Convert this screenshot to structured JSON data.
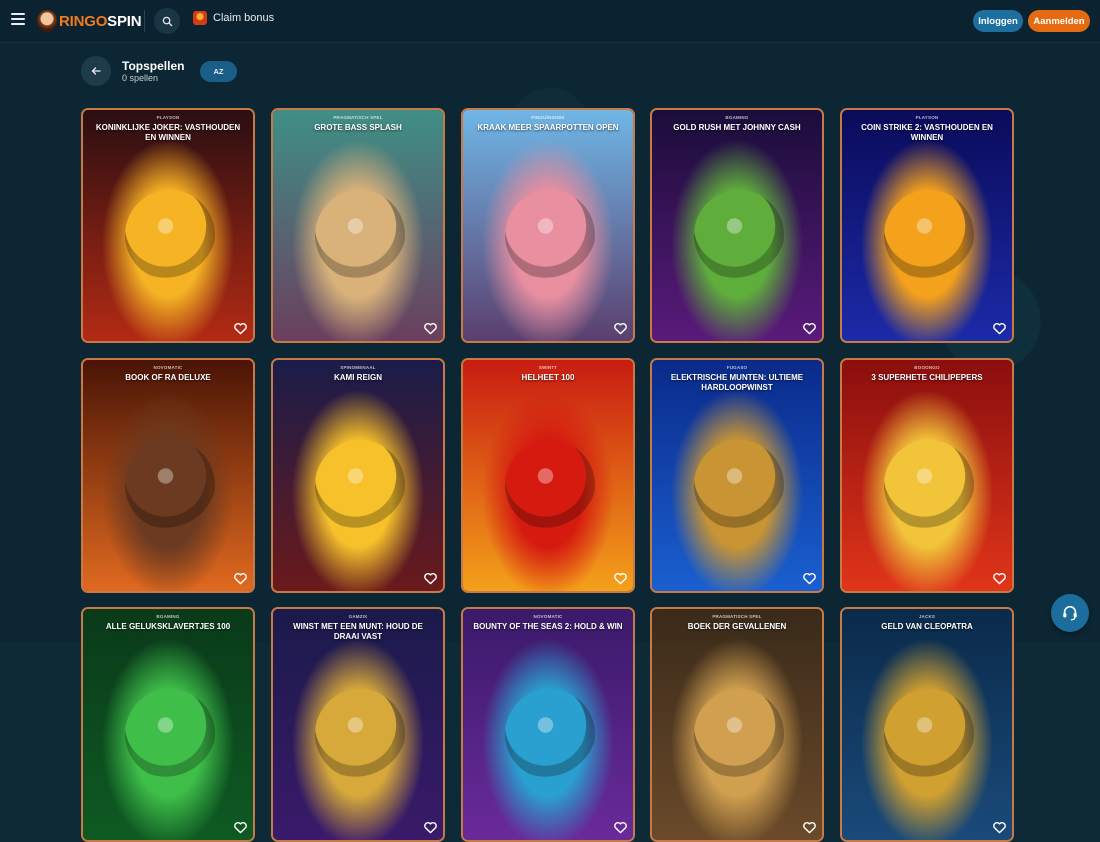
{
  "header": {
    "logo_part1": "RINGO",
    "logo_part2": "SPIN",
    "claim_bonus": "Claim bonus",
    "login_label": "Inloggen",
    "signup_label": "Aanmelden",
    "icons": {
      "menu": "hamburger-menu-icon",
      "search": "search-icon",
      "gift": "gift-icon"
    }
  },
  "page": {
    "title": "Topspellen",
    "count": "0 spellen",
    "sort_label": "AZ"
  },
  "games": [
    {
      "provider": "PLAYSON",
      "name": "KONINKLIJKE JOKER: VASTHOUDEN EN WINNEN",
      "color_top": "#2a0e12",
      "color_bottom": "#b32a14",
      "glow": "#f6b324"
    },
    {
      "provider": "PRAGMATISCH SPEL",
      "name": "GROTE BASS SPLASH",
      "color_top": "#3f8f86",
      "color_bottom": "#6b3f5e",
      "glow": "#d9b27a"
    },
    {
      "provider": "PINGUÏNGINIE",
      "name": "KRAAK MEER SPAARPOTTEN OPEN",
      "color_top": "#6fb6e6",
      "color_bottom": "#5b3f6e",
      "glow": "#e88fa0"
    },
    {
      "provider": "BGAMING",
      "name": "GOLD RUSH MET JOHNNY CASH",
      "color_top": "#1a0d3a",
      "color_bottom": "#5a1a7a",
      "glow": "#5fae3c"
    },
    {
      "provider": "PLAYSON",
      "name": "COIN STRIKE 2: VASTHOUDEN EN WINNEN",
      "color_top": "#0b0b5a",
      "color_bottom": "#1b2aa8",
      "glow": "#f4a11c"
    },
    {
      "provider": "NOVOMATIC",
      "name": "BOOK OF RA DELUXE",
      "color_top": "#4a1406",
      "color_bottom": "#e0691f",
      "glow": "#6b3a20"
    },
    {
      "provider": "SPINOMENAAL",
      "name": "KAMI REIGN",
      "color_top": "#1a1c4a",
      "color_bottom": "#6a1a1c",
      "glow": "#f6c12a"
    },
    {
      "provider": "SWINTT",
      "name": "HELHEET 100",
      "color_top": "#c81c12",
      "color_bottom": "#f4a01a",
      "glow": "#d51a10"
    },
    {
      "provider": "FUGASO",
      "name": "ELEKTRISCHE MUNTEN: ULTIEME HARDLOOPWINST",
      "color_top": "#0a2a8a",
      "color_bottom": "#1a5fd0",
      "glow": "#c99534"
    },
    {
      "provider": "BOOONGO",
      "name": "3 SUPERHETE CHILIPEPERS",
      "color_top": "#8a0e0e",
      "color_bottom": "#e0351a",
      "glow": "#f2c43a"
    },
    {
      "provider": "BGAMING",
      "name": "ALLE GELUKSKLAVERTJES 100",
      "color_top": "#0a3a1a",
      "color_bottom": "#0e5a22",
      "glow": "#3fbf4a"
    },
    {
      "provider": "GAMZIX",
      "name": "WINST MET EEN MUNT: HOUD DE DRAAI VAST",
      "color_top": "#1a1a4a",
      "color_bottom": "#3a1a6a",
      "glow": "#d7a93a"
    },
    {
      "provider": "NOVOMATIC",
      "name": "BOUNTY OF THE SEAS 2: HOLD & WIN",
      "color_top": "#3a1a6a",
      "color_bottom": "#6a2a9a",
      "glow": "#2aa0d0"
    },
    {
      "provider": "PRAGMATISCH SPEL",
      "name": "BOEK DER GEVALLENEN",
      "color_top": "#3a2a1a",
      "color_bottom": "#6a4a2a",
      "glow": "#d0a050"
    },
    {
      "provider": "JACKS",
      "name": "GELD VAN CLEOPATRA",
      "color_top": "#0a2a4a",
      "color_bottom": "#1a4a7a",
      "glow": "#d0a030"
    }
  ],
  "support": {
    "icon": "headset-icon"
  }
}
